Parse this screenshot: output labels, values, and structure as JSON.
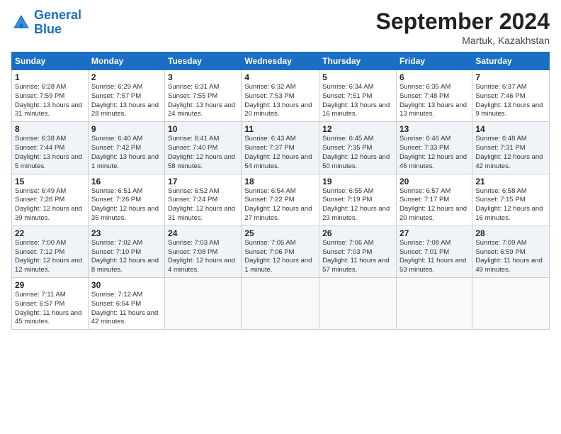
{
  "header": {
    "logo_line1": "General",
    "logo_line2": "Blue",
    "month_title": "September 2024",
    "location": "Martuk, Kazakhstan"
  },
  "weekdays": [
    "Sunday",
    "Monday",
    "Tuesday",
    "Wednesday",
    "Thursday",
    "Friday",
    "Saturday"
  ],
  "weeks": [
    [
      {
        "day": "1",
        "sunrise": "6:28 AM",
        "sunset": "7:59 PM",
        "daylight": "13 hours and 31 minutes."
      },
      {
        "day": "2",
        "sunrise": "6:29 AM",
        "sunset": "7:57 PM",
        "daylight": "13 hours and 28 minutes."
      },
      {
        "day": "3",
        "sunrise": "6:31 AM",
        "sunset": "7:55 PM",
        "daylight": "13 hours and 24 minutes."
      },
      {
        "day": "4",
        "sunrise": "6:32 AM",
        "sunset": "7:53 PM",
        "daylight": "13 hours and 20 minutes."
      },
      {
        "day": "5",
        "sunrise": "6:34 AM",
        "sunset": "7:51 PM",
        "daylight": "13 hours and 16 minutes."
      },
      {
        "day": "6",
        "sunrise": "6:35 AM",
        "sunset": "7:48 PM",
        "daylight": "13 hours and 13 minutes."
      },
      {
        "day": "7",
        "sunrise": "6:37 AM",
        "sunset": "7:46 PM",
        "daylight": "13 hours and 9 minutes."
      }
    ],
    [
      {
        "day": "8",
        "sunrise": "6:38 AM",
        "sunset": "7:44 PM",
        "daylight": "13 hours and 5 minutes."
      },
      {
        "day": "9",
        "sunrise": "6:40 AM",
        "sunset": "7:42 PM",
        "daylight": "13 hours and 1 minute."
      },
      {
        "day": "10",
        "sunrise": "6:41 AM",
        "sunset": "7:40 PM",
        "daylight": "12 hours and 58 minutes."
      },
      {
        "day": "11",
        "sunrise": "6:43 AM",
        "sunset": "7:37 PM",
        "daylight": "12 hours and 54 minutes."
      },
      {
        "day": "12",
        "sunrise": "6:45 AM",
        "sunset": "7:35 PM",
        "daylight": "12 hours and 50 minutes."
      },
      {
        "day": "13",
        "sunrise": "6:46 AM",
        "sunset": "7:33 PM",
        "daylight": "12 hours and 46 minutes."
      },
      {
        "day": "14",
        "sunrise": "6:48 AM",
        "sunset": "7:31 PM",
        "daylight": "12 hours and 42 minutes."
      }
    ],
    [
      {
        "day": "15",
        "sunrise": "6:49 AM",
        "sunset": "7:28 PM",
        "daylight": "12 hours and 39 minutes."
      },
      {
        "day": "16",
        "sunrise": "6:51 AM",
        "sunset": "7:26 PM",
        "daylight": "12 hours and 35 minutes."
      },
      {
        "day": "17",
        "sunrise": "6:52 AM",
        "sunset": "7:24 PM",
        "daylight": "12 hours and 31 minutes."
      },
      {
        "day": "18",
        "sunrise": "6:54 AM",
        "sunset": "7:22 PM",
        "daylight": "12 hours and 27 minutes."
      },
      {
        "day": "19",
        "sunrise": "6:55 AM",
        "sunset": "7:19 PM",
        "daylight": "12 hours and 23 minutes."
      },
      {
        "day": "20",
        "sunrise": "6:57 AM",
        "sunset": "7:17 PM",
        "daylight": "12 hours and 20 minutes."
      },
      {
        "day": "21",
        "sunrise": "6:58 AM",
        "sunset": "7:15 PM",
        "daylight": "12 hours and 16 minutes."
      }
    ],
    [
      {
        "day": "22",
        "sunrise": "7:00 AM",
        "sunset": "7:12 PM",
        "daylight": "12 hours and 12 minutes."
      },
      {
        "day": "23",
        "sunrise": "7:02 AM",
        "sunset": "7:10 PM",
        "daylight": "12 hours and 8 minutes."
      },
      {
        "day": "24",
        "sunrise": "7:03 AM",
        "sunset": "7:08 PM",
        "daylight": "12 hours and 4 minutes."
      },
      {
        "day": "25",
        "sunrise": "7:05 AM",
        "sunset": "7:06 PM",
        "daylight": "12 hours and 1 minute."
      },
      {
        "day": "26",
        "sunrise": "7:06 AM",
        "sunset": "7:03 PM",
        "daylight": "11 hours and 57 minutes."
      },
      {
        "day": "27",
        "sunrise": "7:08 AM",
        "sunset": "7:01 PM",
        "daylight": "11 hours and 53 minutes."
      },
      {
        "day": "28",
        "sunrise": "7:09 AM",
        "sunset": "6:59 PM",
        "daylight": "11 hours and 49 minutes."
      }
    ],
    [
      {
        "day": "29",
        "sunrise": "7:11 AM",
        "sunset": "6:57 PM",
        "daylight": "11 hours and 45 minutes."
      },
      {
        "day": "30",
        "sunrise": "7:12 AM",
        "sunset": "6:54 PM",
        "daylight": "11 hours and 42 minutes."
      },
      null,
      null,
      null,
      null,
      null
    ]
  ]
}
